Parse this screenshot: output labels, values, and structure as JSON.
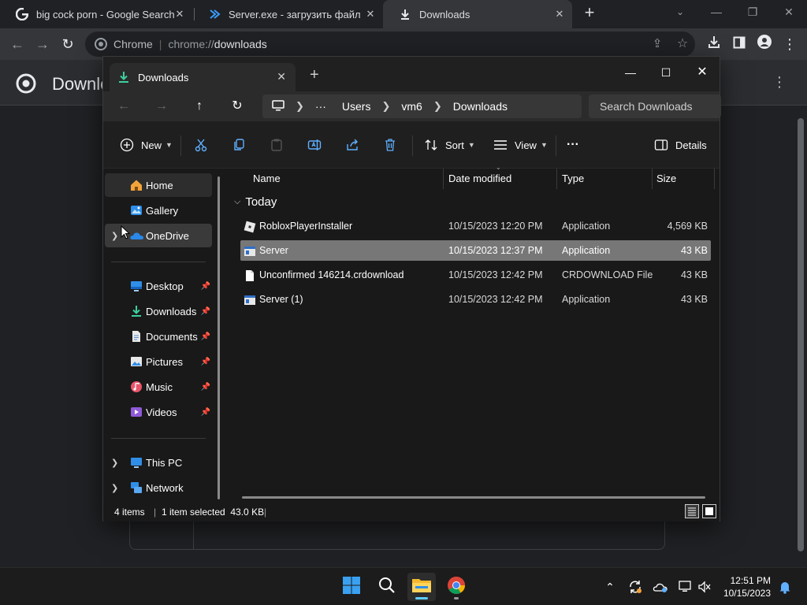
{
  "chrome": {
    "tabs": [
      {
        "title": "big cock porn - Google Search",
        "icon": "google-icon"
      },
      {
        "title": "Server.exe - загрузить файл",
        "icon": "vscode-icon"
      },
      {
        "title": "Downloads",
        "icon": "download-icon"
      }
    ],
    "tab_close_glyph": "✕",
    "new_tab_glyph": "+",
    "omnibox": {
      "site": "Chrome",
      "divider": "|",
      "scheme": "chrome://",
      "path": "downloads"
    },
    "page_title": "Downloads"
  },
  "explorer": {
    "tab_title": "Downloads",
    "breadcrumb": [
      "Users",
      "vm6",
      "Downloads"
    ],
    "breadcrumb_more": "···",
    "search_placeholder": "Search Downloads",
    "commands": {
      "new": "New",
      "sort": "Sort",
      "view": "View",
      "more": "···",
      "details": "Details"
    },
    "sidebar": {
      "top": [
        {
          "label": "Home",
          "icon": "home-icon",
          "selected": true
        },
        {
          "label": "Gallery",
          "icon": "gallery-icon"
        },
        {
          "label": "OneDrive",
          "icon": "onedrive-icon",
          "hover": true
        }
      ],
      "quick": [
        {
          "label": "Desktop",
          "icon": "desktop-icon"
        },
        {
          "label": "Downloads",
          "icon": "downloads-icon"
        },
        {
          "label": "Documents",
          "icon": "documents-icon"
        },
        {
          "label": "Pictures",
          "icon": "pictures-icon"
        },
        {
          "label": "Music",
          "icon": "music-icon"
        },
        {
          "label": "Videos",
          "icon": "videos-icon"
        }
      ],
      "bottom": [
        {
          "label": "This PC",
          "icon": "this-pc-icon"
        },
        {
          "label": "Network",
          "icon": "network-icon"
        }
      ]
    },
    "columns": [
      "Name",
      "Date modified",
      "Type",
      "Size"
    ],
    "group": "Today",
    "files": [
      {
        "name": "RobloxPlayerInstaller",
        "date": "10/15/2023 12:20 PM",
        "type": "Application",
        "size": "4,569 KB",
        "icon": "roblox-icon"
      },
      {
        "name": "Server",
        "date": "10/15/2023 12:37 PM",
        "type": "Application",
        "size": "43 KB",
        "icon": "app-icon",
        "selected": true
      },
      {
        "name": "Unconfirmed 146214.crdownload",
        "date": "10/15/2023 12:42 PM",
        "type": "CRDOWNLOAD File",
        "size": "43 KB",
        "icon": "file-icon"
      },
      {
        "name": "Server (1)",
        "date": "10/15/2023 12:42 PM",
        "type": "Application",
        "size": "43 KB",
        "icon": "app-icon"
      }
    ],
    "status": {
      "count": "4 items",
      "sep": "|",
      "selection": "1 item selected  43.0 KB"
    }
  },
  "taskbar": {
    "time": "12:51 PM",
    "date": "10/15/2023"
  },
  "colors": {
    "accent": "#0078d4",
    "selection": "#777777",
    "chrome_dark": "#202124"
  }
}
